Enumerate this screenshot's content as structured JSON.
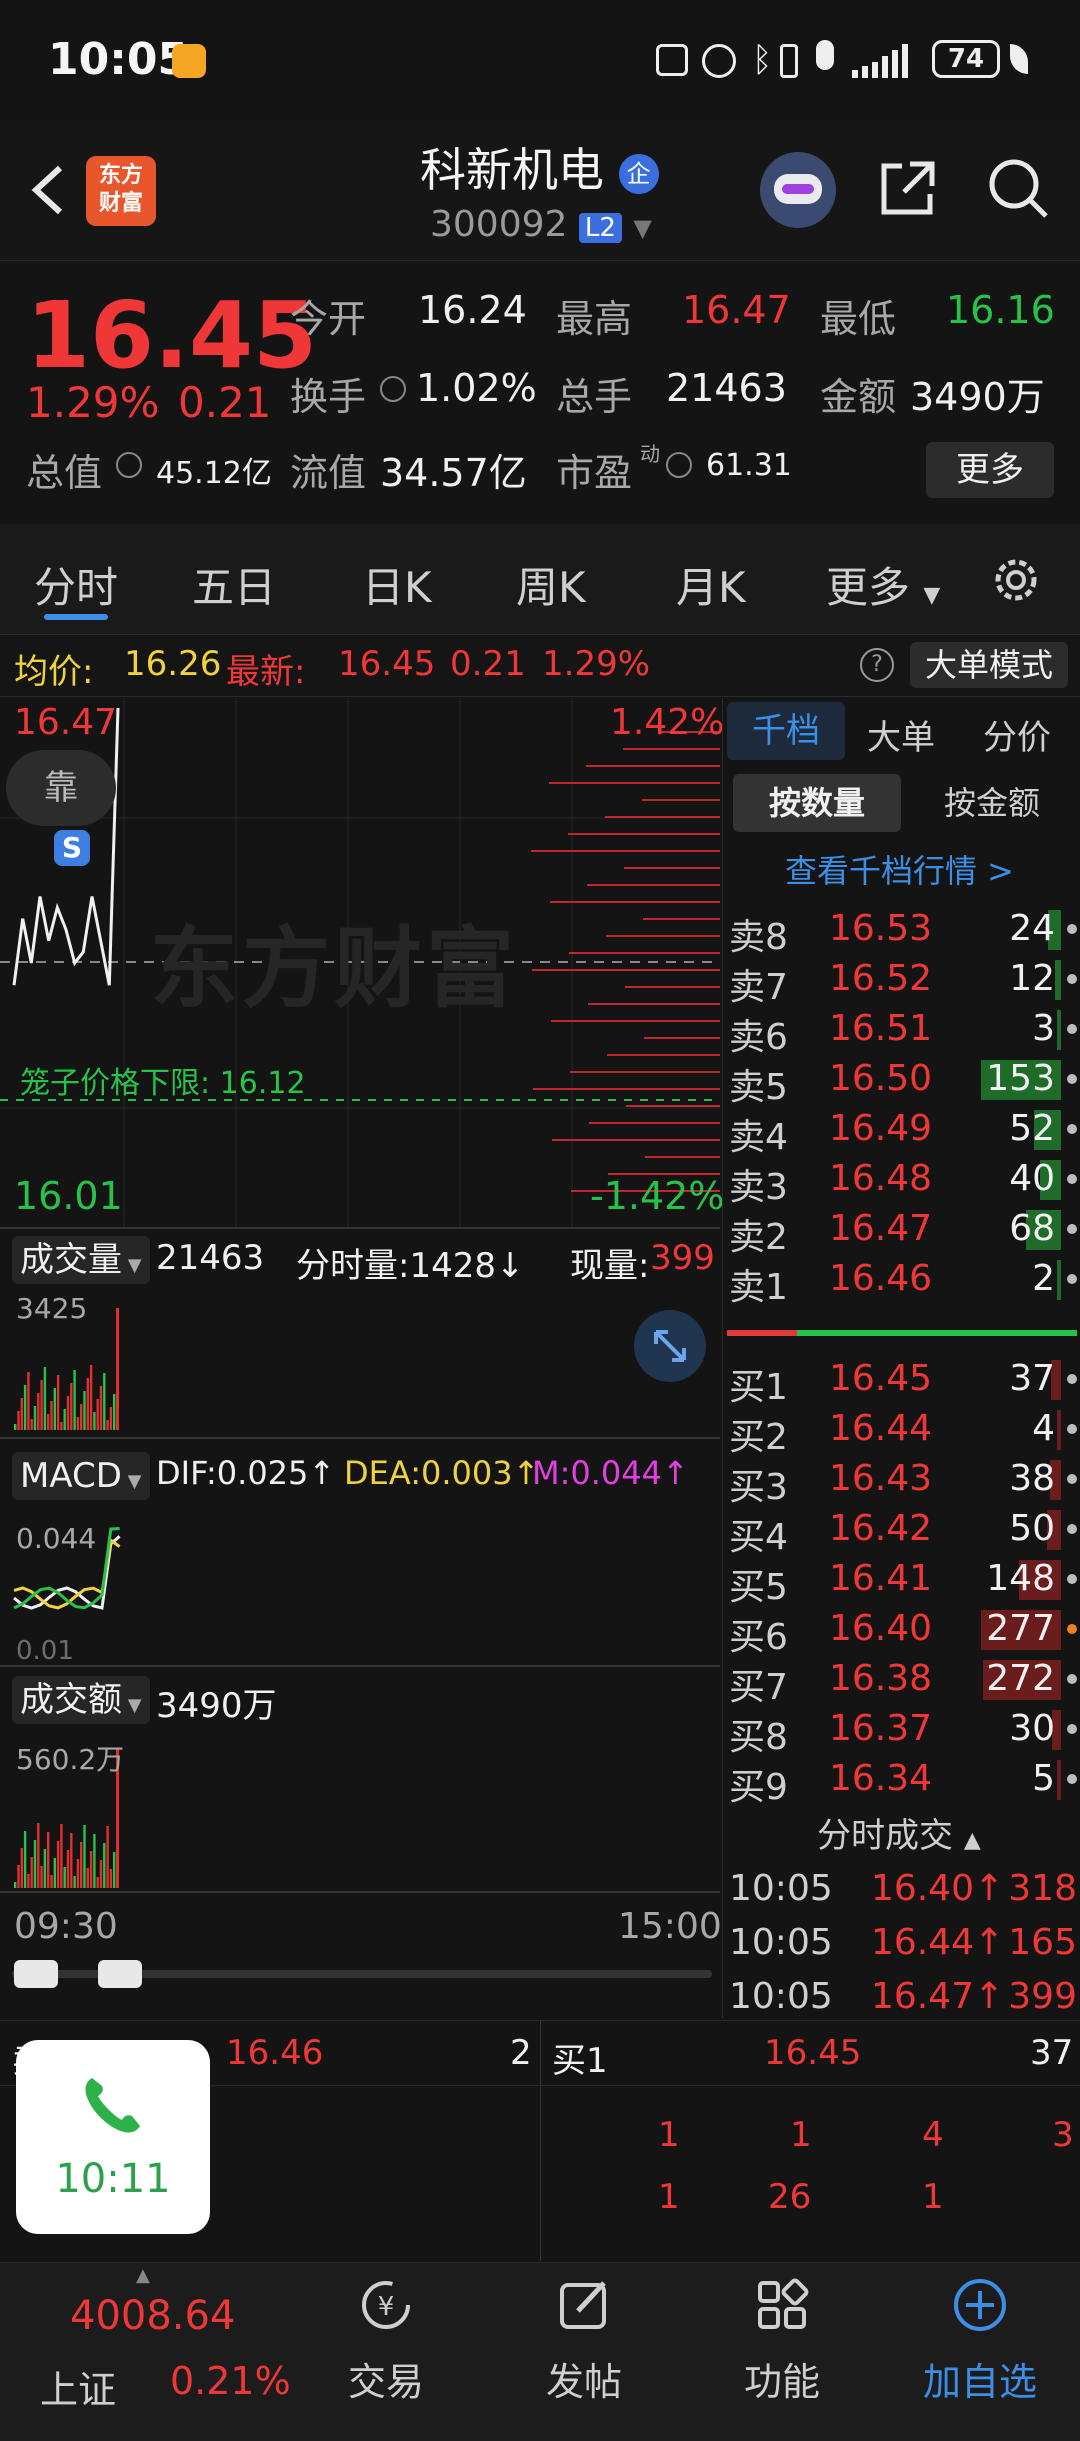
{
  "status_bar": {
    "time": "10:05",
    "battery": "74"
  },
  "header": {
    "back_icon": "chevron-left-icon",
    "logo_line1": "东方",
    "logo_line2": "财富",
    "stock_name": "科新机电",
    "badge": "企",
    "stock_code": "300092",
    "level": "L2"
  },
  "quote": {
    "price": "16.45",
    "change_pct": "1.29%",
    "change": "0.21",
    "open_label": "今开",
    "open": "16.24",
    "high_label": "最高",
    "high": "16.47",
    "low_label": "最低",
    "low": "16.16",
    "turnover_label": "换手",
    "turnover": "1.02%",
    "volume_label": "总手",
    "volume": "21463",
    "amount_label": "金额",
    "amount": "3490万",
    "mktcap_label": "总值",
    "mktcap": "45.12亿",
    "float_label": "流值",
    "float": "34.57亿",
    "pe_label": "市盈",
    "pe_sup": "动",
    "pe": "61.31",
    "more": "更多"
  },
  "tabs": [
    "分时",
    "五日",
    "日K",
    "周K",
    "月K",
    "更多"
  ],
  "avg_bar": {
    "avg_label": "均价:",
    "avg": "16.26",
    "latest_label": "最新:",
    "latest": "16.45",
    "latest_change": "0.21",
    "latest_pct": "1.29%",
    "mode_button": "大单模式"
  },
  "chart": {
    "price_high": "16.47",
    "price_low": "16.01",
    "pct_high": "1.42%",
    "pct_low": "-1.42%",
    "kao_label": "靠",
    "s_marker": "S",
    "watermark": "东方财富",
    "limit_label": "笼子价格下限:",
    "limit_value": "16.12",
    "vol_label": "成交量",
    "vol_total": "21463",
    "vol_min_label": "分时量:1428↓",
    "vol_now_label": "现量:",
    "vol_now": "399",
    "vol_max": "3425",
    "macd_label": "MACD",
    "dif": "DIF:0.025↑",
    "dea": "DEA:0.003↑",
    "m": "M:0.044↑",
    "macd_max": "0.044",
    "macd_min": "0.01",
    "amt_label": "成交额",
    "amt_total": "3490万",
    "amt_max": "560.2万",
    "time_start": "09:30",
    "time_end": "15:00"
  },
  "chart_data": {
    "type": "line",
    "series": [
      {
        "values": [
          16.22,
          16.28,
          16.24,
          16.3,
          16.26,
          16.29,
          16.27,
          16.24,
          16.25,
          16.3,
          16.26,
          16.22,
          16.47
        ]
      }
    ],
    "ylim": [
      16.01,
      16.47
    ],
    "yclose": 16.24
  },
  "book": {
    "tabs": [
      "千档",
      "大单",
      "分价"
    ],
    "sub_tabs": [
      "按数量",
      "按金额"
    ],
    "link": "查看千档行情 >",
    "asks": [
      {
        "label": "卖8",
        "price": "16.53",
        "qty": "24",
        "level": 0.16
      },
      {
        "label": "卖7",
        "price": "16.52",
        "qty": "12",
        "level": 0.08
      },
      {
        "label": "卖6",
        "price": "16.51",
        "qty": "3",
        "level": 0.02
      },
      {
        "label": "卖5",
        "price": "16.50",
        "qty": "153",
        "level": 1.0
      },
      {
        "label": "卖4",
        "price": "16.49",
        "qty": "52",
        "level": 0.34
      },
      {
        "label": "卖3",
        "price": "16.48",
        "qty": "40",
        "level": 0.26
      },
      {
        "label": "卖2",
        "price": "16.47",
        "qty": "68",
        "level": 0.44
      },
      {
        "label": "卖1",
        "price": "16.46",
        "qty": "2",
        "level": 0.01
      }
    ],
    "bids": [
      {
        "label": "买1",
        "price": "16.45",
        "qty": "37",
        "level": 0.13
      },
      {
        "label": "买2",
        "price": "16.44",
        "qty": "4",
        "level": 0.01
      },
      {
        "label": "买3",
        "price": "16.43",
        "qty": "38",
        "level": 0.14
      },
      {
        "label": "买4",
        "price": "16.42",
        "qty": "50",
        "level": 0.18
      },
      {
        "label": "买5",
        "price": "16.41",
        "qty": "148",
        "level": 0.53
      },
      {
        "label": "买6",
        "price": "16.40",
        "qty": "277",
        "level": 1.0
      },
      {
        "label": "买7",
        "price": "16.38",
        "qty": "272",
        "level": 0.98
      },
      {
        "label": "买8",
        "price": "16.37",
        "qty": "30",
        "level": 0.11
      },
      {
        "label": "买9",
        "price": "16.34",
        "qty": "5",
        "level": 0.02
      }
    ],
    "trades_label": "分时成交",
    "trades": [
      {
        "time": "10:05",
        "price": "16.40↑",
        "qty": "318"
      },
      {
        "time": "10:05",
        "price": "16.44↑",
        "qty": "165"
      },
      {
        "time": "10:05",
        "price": "16.47↑",
        "qty": "399"
      }
    ]
  },
  "ticker": {
    "ask_label": "卖1",
    "ask_price": "16.46",
    "ask_qty": "2",
    "bid_label": "买1",
    "bid_price": "16.45",
    "bid_qty": "37",
    "row1": [
      "1",
      "1",
      "4",
      "3"
    ],
    "row2": [
      "1",
      "26",
      "1"
    ]
  },
  "call_bubble": {
    "time": "10:11"
  },
  "nav": {
    "index_value": "4008.64",
    "index_name": "上证",
    "index_pct": "0.21%",
    "items": [
      "交易",
      "发帖",
      "功能",
      "加自选"
    ]
  }
}
